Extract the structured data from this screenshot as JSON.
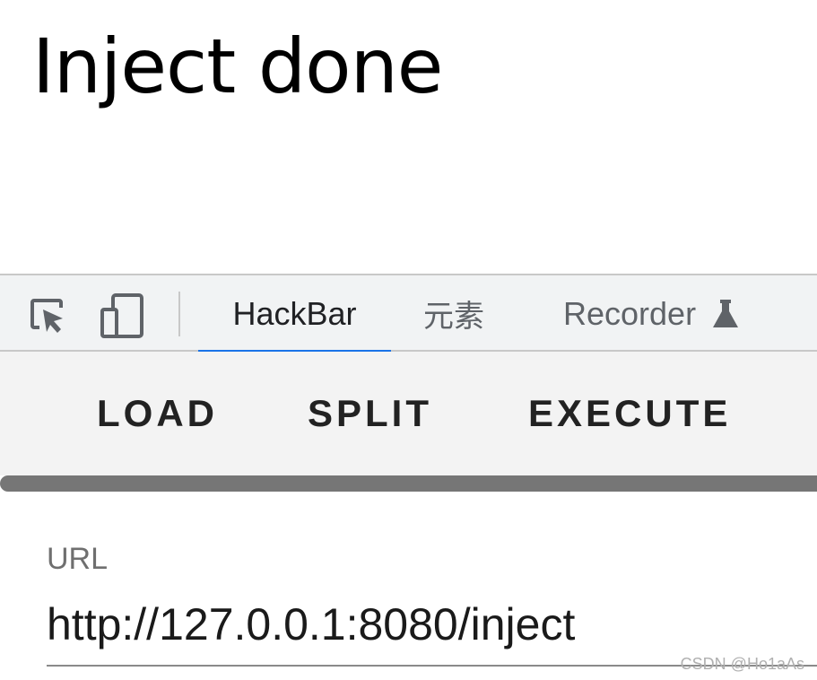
{
  "page": {
    "heading": "Inject done"
  },
  "devtools": {
    "icons": {
      "inspect": "element-picker-icon",
      "device": "device-toolbar-icon",
      "recorder_badge": "flask-icon"
    },
    "tabs": [
      {
        "label": "HackBar",
        "active": true
      },
      {
        "label": "元素",
        "active": false
      },
      {
        "label": "Recorder",
        "active": false
      }
    ],
    "colors": {
      "active_tab_indicator": "#1a73e8",
      "tab_strip_bg": "#f1f3f4"
    }
  },
  "hackbar": {
    "load_label": "LOAD",
    "split_label": "SPLIT",
    "execute_label": "EXECUTE",
    "url_label": "URL",
    "url_value": "http://127.0.0.1:8080/inject"
  },
  "watermark": "CSDN @Ho1aAs"
}
